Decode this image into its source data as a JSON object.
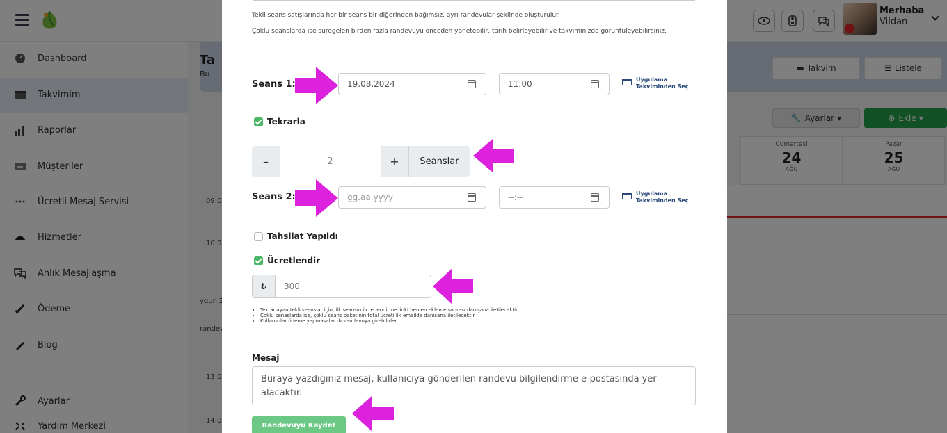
{
  "topbar": {
    "greeting": "Merhaba",
    "user_name": "Vildan"
  },
  "sidebar": {
    "items": [
      {
        "label": "Dashboard",
        "icon": "dashboard-icon"
      },
      {
        "label": "Takvimim",
        "icon": "calendar-icon"
      },
      {
        "label": "Raporlar",
        "icon": "bar-chart-icon"
      },
      {
        "label": "Müşteriler",
        "icon": "users-icon"
      },
      {
        "label": "Ücretli Mesaj Servisi",
        "icon": "dots-icon"
      },
      {
        "label": "Hizmetler",
        "icon": "services-icon"
      },
      {
        "label": "Anlık Mesajlaşma",
        "icon": "chat-icon"
      },
      {
        "label": "Ödeme",
        "icon": "payment-icon"
      },
      {
        "label": "Blog",
        "icon": "blog-icon"
      },
      {
        "label": "Ayarlar",
        "icon": "wrench-icon"
      },
      {
        "label": "Yardım Merkezi",
        "icon": "help-icon"
      }
    ]
  },
  "main": {
    "title_partial": "Ta",
    "subtitle_partial": "Bu",
    "view_calendar": "Takvim",
    "view_list": "Listele",
    "settings_btn": "Ayarlar",
    "add_btn": "Ekle",
    "days": [
      {
        "name": "Cumartesi",
        "date": "24",
        "month": "AĞU"
      },
      {
        "name": "Pazar",
        "date": "25",
        "month": "AĞU"
      }
    ],
    "times": [
      "09:0",
      "10:0",
      "ygun Z",
      "randev",
      "13:0",
      "14:0"
    ]
  },
  "modal": {
    "info1": "Tekli seans satışlarında her bir seans bir diğerinden bağımsız, ayrı randevular şeklinde oluşturulur.",
    "info2": "Çoklu seanslarda ise süregelen birden fazla randevuyu önceden yönetebilir, tarih belirleyebilir ve takviminizde görüntüleyebilirsiniz.",
    "session1_label": "Seans 1:",
    "session1_date": "19.08.2024",
    "session1_time": "11:00",
    "picker_line1": "Uygulama",
    "picker_line2": "Takviminden Seç",
    "repeat_label": "Tekrarla",
    "stepper_value": "2",
    "stepper_minus": "–",
    "stepper_plus": "+",
    "sessions_btn": "Seanslar",
    "session2_label": "Seans 2:",
    "session2_date_placeholder": "gg.aa.yyyy",
    "session2_time_placeholder": "--:--",
    "collected_label": "Tahsilat Yapıldı",
    "charge_label": "Ücretlendir",
    "currency": "₺",
    "amount": "300",
    "notes": [
      "Tekrarlayan tekli seanslar için, ilk seansın ücretlendirme linki hemen ekleme sonrası danışana iletilecektir.",
      "Çoklu senaslarda ise, çoklu seans paketinin total ücreti ilk emailde danışana iletilecektir.",
      "Kullanıcılar ödeme yapmasalar da randevuya girebilirler."
    ],
    "message_label": "Mesaj",
    "message_placeholder": "Buraya yazdığınız mesaj, kullanıcıya gönderilen randevu bilgilendirme e-postasında yer alacaktır.",
    "save_btn": "Randevuyu Kaydet"
  },
  "colors": {
    "accent_green": "#4ab866",
    "save_green": "#6bc885",
    "arrow_magenta": "#dd22dd",
    "navy_text": "#2a4a7a"
  }
}
